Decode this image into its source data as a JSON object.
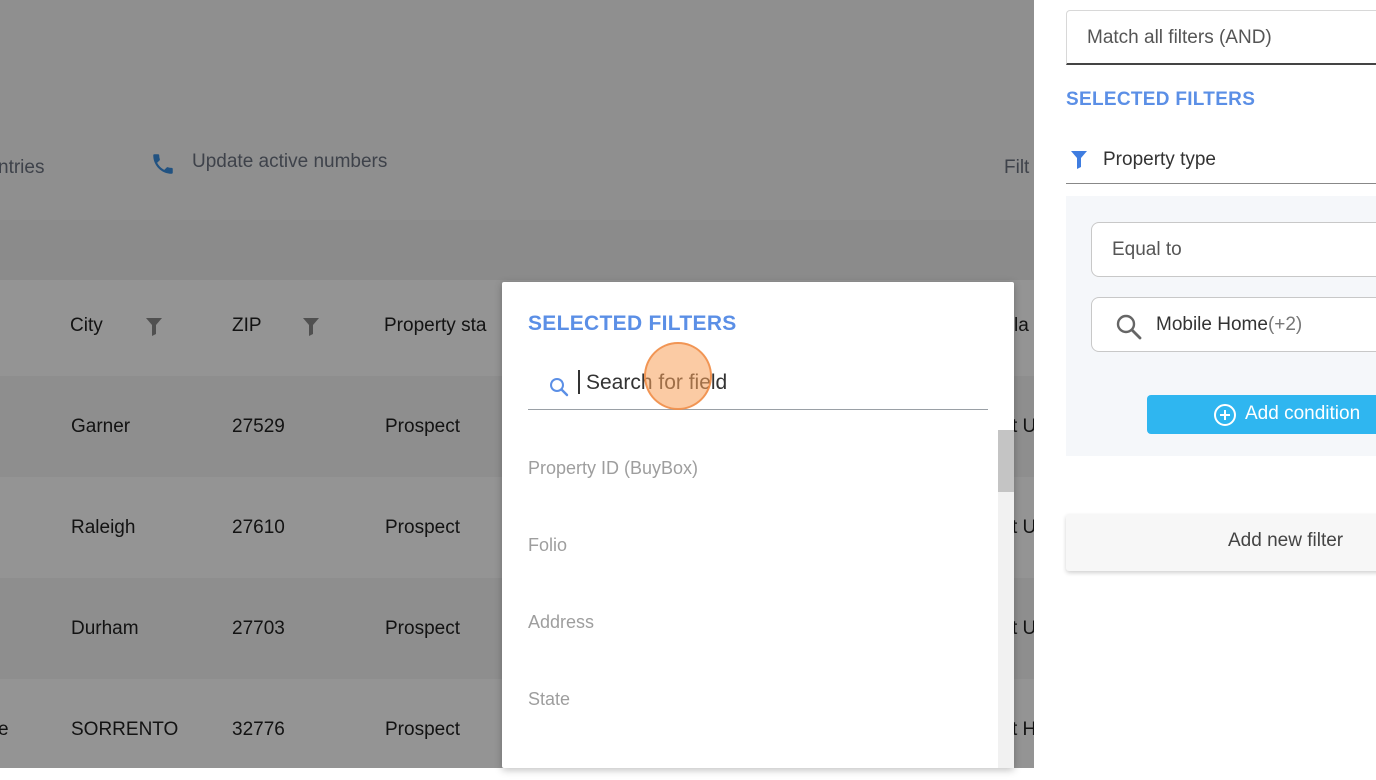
{
  "toolbar": {
    "entries_fragment": "ntries",
    "update_label": "Update active numbers",
    "filter_fragment": "Filt"
  },
  "table": {
    "headers": [
      "City",
      "ZIP",
      "Property sta",
      "la"
    ],
    "rows": [
      {
        "lead": "",
        "city": "Garner",
        "zip": "27529",
        "status": "Prospect",
        "tail": "t U"
      },
      {
        "lead": "",
        "city": "Raleigh",
        "zip": "27610",
        "status": "Prospect",
        "tail": "t U"
      },
      {
        "lead": "",
        "city": "Durham",
        "zip": "27703",
        "status": "Prospect",
        "tail": "t U"
      },
      {
        "lead": "e",
        "city": "SORRENTO",
        "zip": "32776",
        "status": "Prospect",
        "tail": "t H"
      }
    ]
  },
  "popup": {
    "title": "SELECTED FILTERS",
    "search_placeholder": "Search for field",
    "options": [
      "Property ID (BuyBox)",
      "Folio",
      "Address",
      "State"
    ]
  },
  "panel": {
    "match_mode": "Match all filters (AND)",
    "title": "SELECTED FILTERS",
    "filter_name": "Property type",
    "condition_operator": "Equal to",
    "condition_value": "Mobile Home",
    "condition_value_more": "(+2)",
    "add_condition_label": "Add condition",
    "add_filter_label": "Add new filter"
  },
  "colors": {
    "accent": "#5b8fe6",
    "button": "#2fb6f0",
    "overlay": "rgba(0,0,0,0.42)",
    "click_indicator": "#f7a05a"
  },
  "icons": [
    "phone-icon",
    "funnel-icon",
    "search-icon",
    "plus-circle-icon"
  ]
}
